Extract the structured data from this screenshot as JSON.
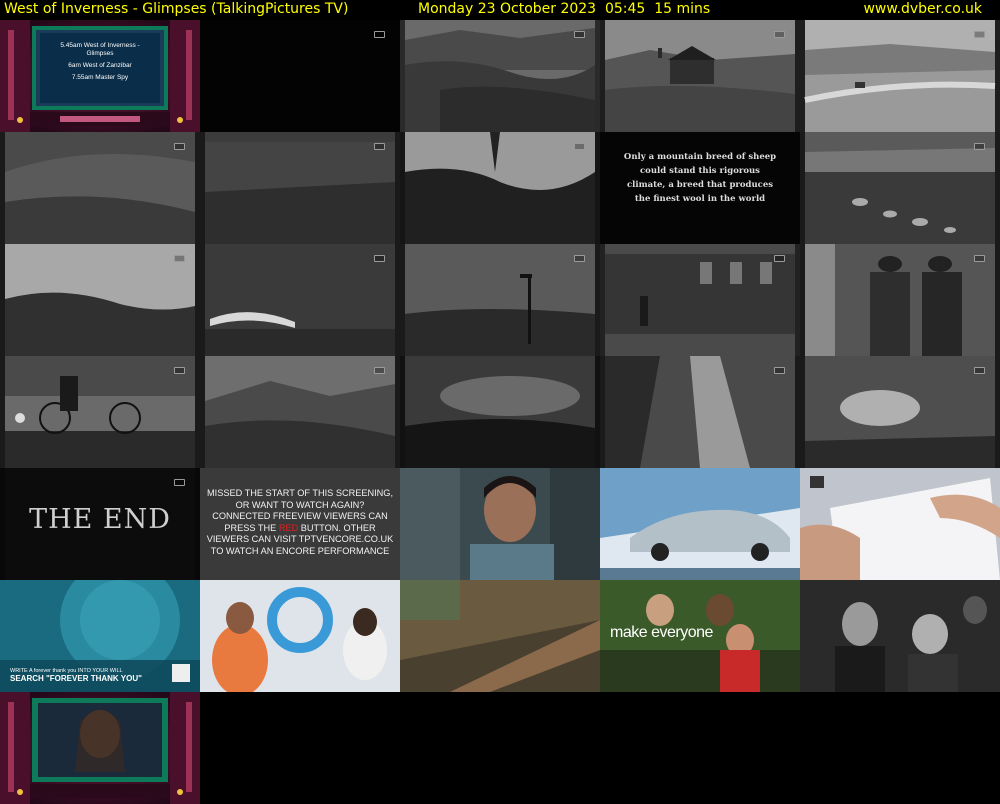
{
  "header": {
    "programme": "West of Inverness - Glimpses (TalkingPictures TV)",
    "datetime": "Monday 23 October 2023  05:45  15 mins",
    "site": "www.dvber.co.uk"
  },
  "frames": {
    "cinema_schedule": [
      "5.45am West of Inverness - Glimpses",
      "6am West of Zanzibar",
      "7.55am Master Spy"
    ],
    "intertitle": "Only a mountain breed of sheep could stand this rigorous climate, a breed that produces the finest wool in the world",
    "end_title": "THE END",
    "encore_line1": "MISSED THE START OF THIS SCREENING, OR WANT TO WATCH AGAIN? CONNECTED FREEVIEW VIEWERS CAN PRESS THE ",
    "encore_red": "RED",
    "encore_line2": " BUTTON. OTHER VIEWERS CAN VISIT TPTVENCORE.CO.UK TO WATCH AN ENCORE PERFORMANCE",
    "ad_will_small": "WRITE A forever thank you INTO YOUR WILL",
    "ad_will_big": "SEARCH \"FOREVER THANK YOU\"",
    "ad_make": "make everyone"
  },
  "colors": {
    "header_text": "#ffff00",
    "background": "#000000"
  }
}
